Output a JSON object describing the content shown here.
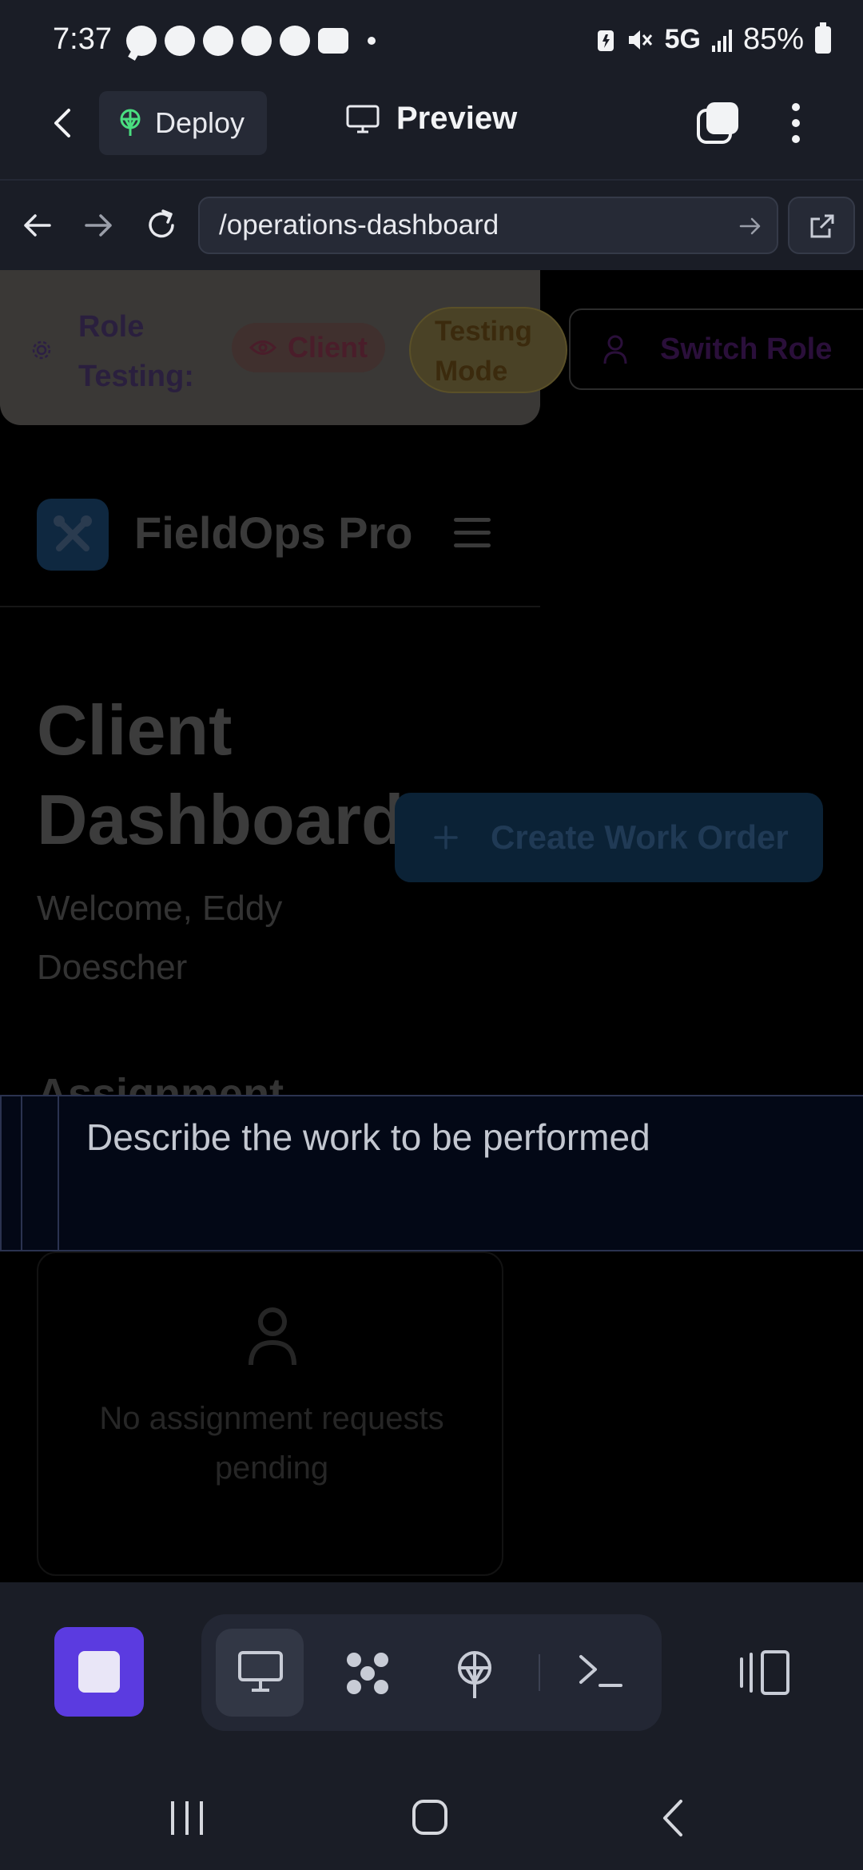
{
  "status_bar": {
    "time": "7:37",
    "network": "5G",
    "battery": "85%",
    "notification_icons": [
      "chat-icon",
      "messenger-icon",
      "messenger-icon",
      "messenger-icon",
      "messenger-icon",
      "wallet-icon"
    ]
  },
  "app_header": {
    "deploy_label": "Deploy",
    "preview_label": "Preview"
  },
  "url_bar": {
    "url": "/operations-dashboard"
  },
  "role_bar": {
    "label": "Role Testing:",
    "role": "Client",
    "mode_badge": "Testing Mode",
    "switch_button": "Switch Role"
  },
  "brand": {
    "name": "FieldOps Pro"
  },
  "dashboard": {
    "title": "Client Dashboard",
    "welcome": "Welcome, Eddy Doescher",
    "create_button": "Create Work Order",
    "section_heading": "Assignment",
    "empty_state": "No assignment requests pending"
  },
  "work_description": {
    "placeholder": "Describe the work to be performed",
    "value": ""
  },
  "colors": {
    "accent_purple": "#5b3be0",
    "chrome_bg": "#1a1d26",
    "deploy_icon_green": "#4ade80"
  }
}
